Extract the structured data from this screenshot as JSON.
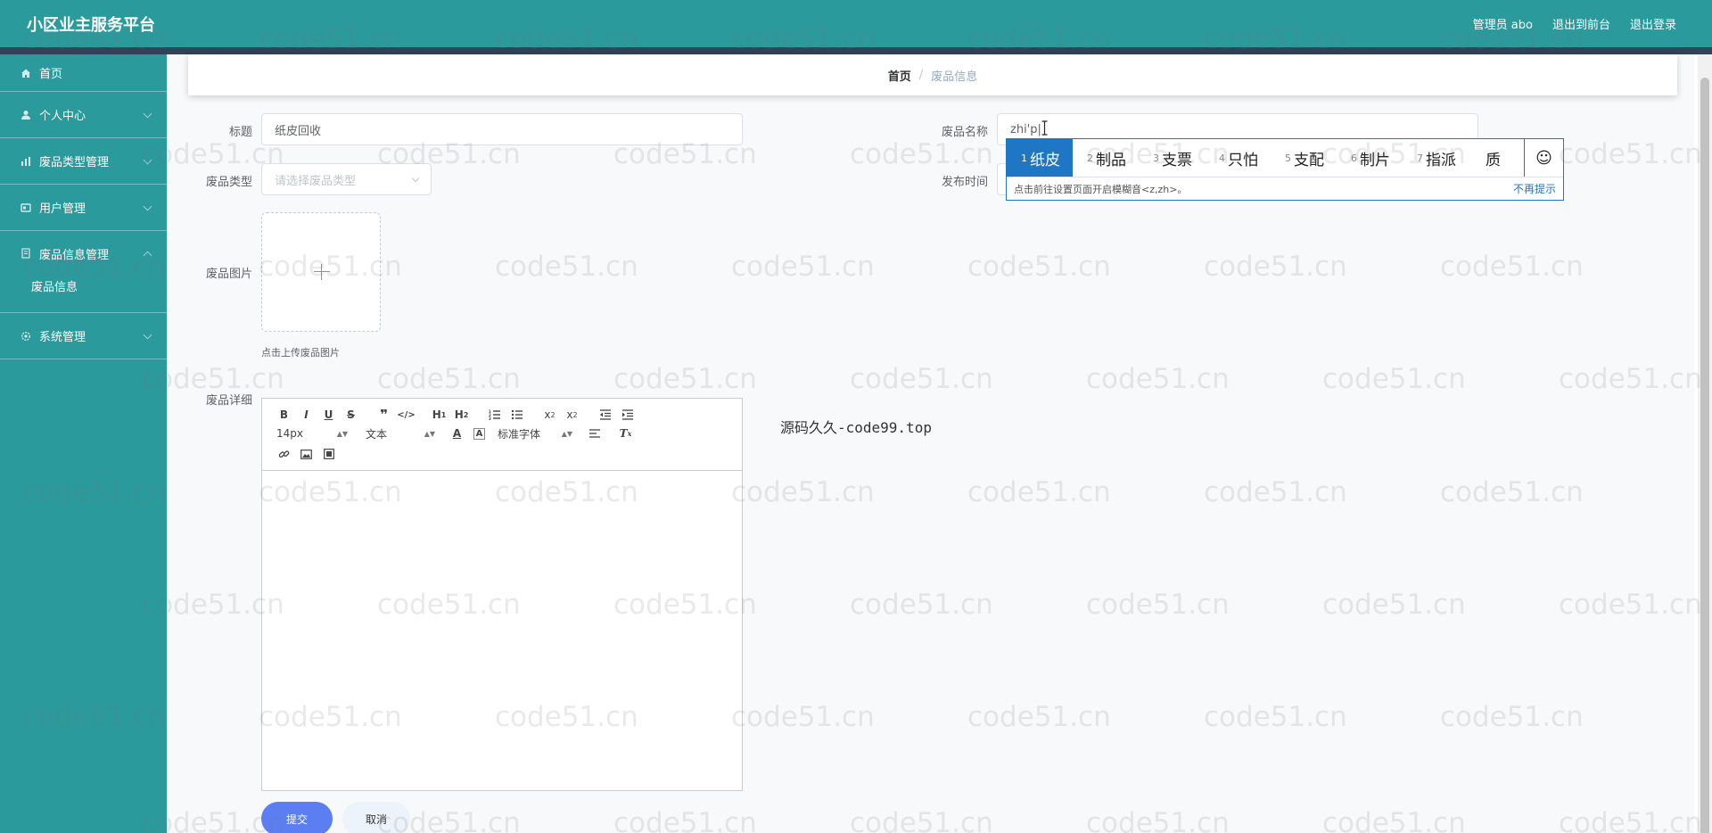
{
  "header": {
    "title": "小区业主服务平台",
    "admin_label": "管理员 abo",
    "to_front_label": "退出到前台",
    "logout_label": "退出登录"
  },
  "sidebar": {
    "items": [
      {
        "label": "首页",
        "icon": "home-icon"
      },
      {
        "label": "个人中心",
        "icon": "user-icon"
      },
      {
        "label": "废品类型管理",
        "icon": "chart-icon"
      },
      {
        "label": "用户管理",
        "icon": "id-card-icon"
      },
      {
        "label": "废品信息管理",
        "icon": "document-icon"
      },
      {
        "label": "系统管理",
        "icon": "gear-icon"
      }
    ],
    "submenu_label": "废品信息"
  },
  "breadcrumb": {
    "home": "首页",
    "separator": "/",
    "current": "废品信息"
  },
  "form": {
    "title_label": "标题",
    "title_value": "纸皮回收",
    "name_label": "废品名称",
    "name_value": "zhi'p|",
    "type_label": "废品类型",
    "type_placeholder": "请选择废品类型",
    "time_label": "发布时间",
    "image_label": "废品图片",
    "upload_tip": "点击上传废品图片",
    "detail_label": "废品详细"
  },
  "editor": {
    "font_size": "14px",
    "header_picker": "文本",
    "font_picker": "标准字体"
  },
  "buttons": {
    "submit": "提交",
    "cancel": "取消"
  },
  "overlay_text": "源码久久-code99.top",
  "ime": {
    "candidates": [
      {
        "n": "1",
        "text": "纸皮"
      },
      {
        "n": "2",
        "text": "制品"
      },
      {
        "n": "3",
        "text": "支票"
      },
      {
        "n": "4",
        "text": "只怕"
      },
      {
        "n": "5",
        "text": "支配"
      },
      {
        "n": "6",
        "text": "制片"
      },
      {
        "n": "7",
        "text": "指派"
      },
      {
        "n": "",
        "text": "质"
      }
    ],
    "emoji": "☺",
    "hint": "点击前往设置页面开启模糊音<z,zh>。",
    "dismiss": "不再提示"
  },
  "watermark": "code51.cn",
  "colors": {
    "header_bg": "#2a9a9c",
    "sidebar_bg": "#2a9a9c",
    "stripe": "#324257",
    "primary_button": "#5b7ef3",
    "ime_accent": "#1e76c5"
  }
}
